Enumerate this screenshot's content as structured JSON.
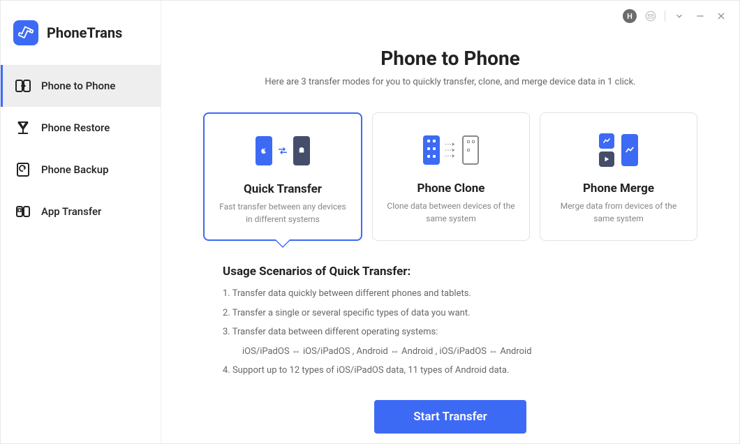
{
  "app": {
    "name": "PhoneTrans",
    "avatar_letter": "H"
  },
  "sidebar": {
    "items": [
      {
        "label": "Phone to Phone"
      },
      {
        "label": "Phone Restore"
      },
      {
        "label": "Phone Backup"
      },
      {
        "label": "App Transfer"
      }
    ]
  },
  "page": {
    "title": "Phone to Phone",
    "subtitle": "Here are 3 transfer modes for you to quickly transfer, clone, and merge device data in 1 click."
  },
  "cards": [
    {
      "title": "Quick Transfer",
      "desc": "Fast transfer between any devices in different systems"
    },
    {
      "title": "Phone Clone",
      "desc": "Clone data between devices of the same system"
    },
    {
      "title": "Phone Merge",
      "desc": "Merge data from devices of the same system"
    }
  ],
  "scenarios": {
    "title": "Usage Scenarios of Quick Transfer:",
    "lines": [
      "1. Transfer data quickly between different phones and tablets.",
      "2. Transfer a single or several specific types of data you want.",
      "3. Transfer data between different operating systems:",
      "iOS/iPadOS ⇔ iOS/iPadOS ,   Android ⇔ Android ,   iOS/iPadOS ⇔ Android",
      "4. Support up to 12 types of iOS/iPadOS data, 11 types of Android data."
    ]
  },
  "actions": {
    "start": "Start Transfer"
  }
}
